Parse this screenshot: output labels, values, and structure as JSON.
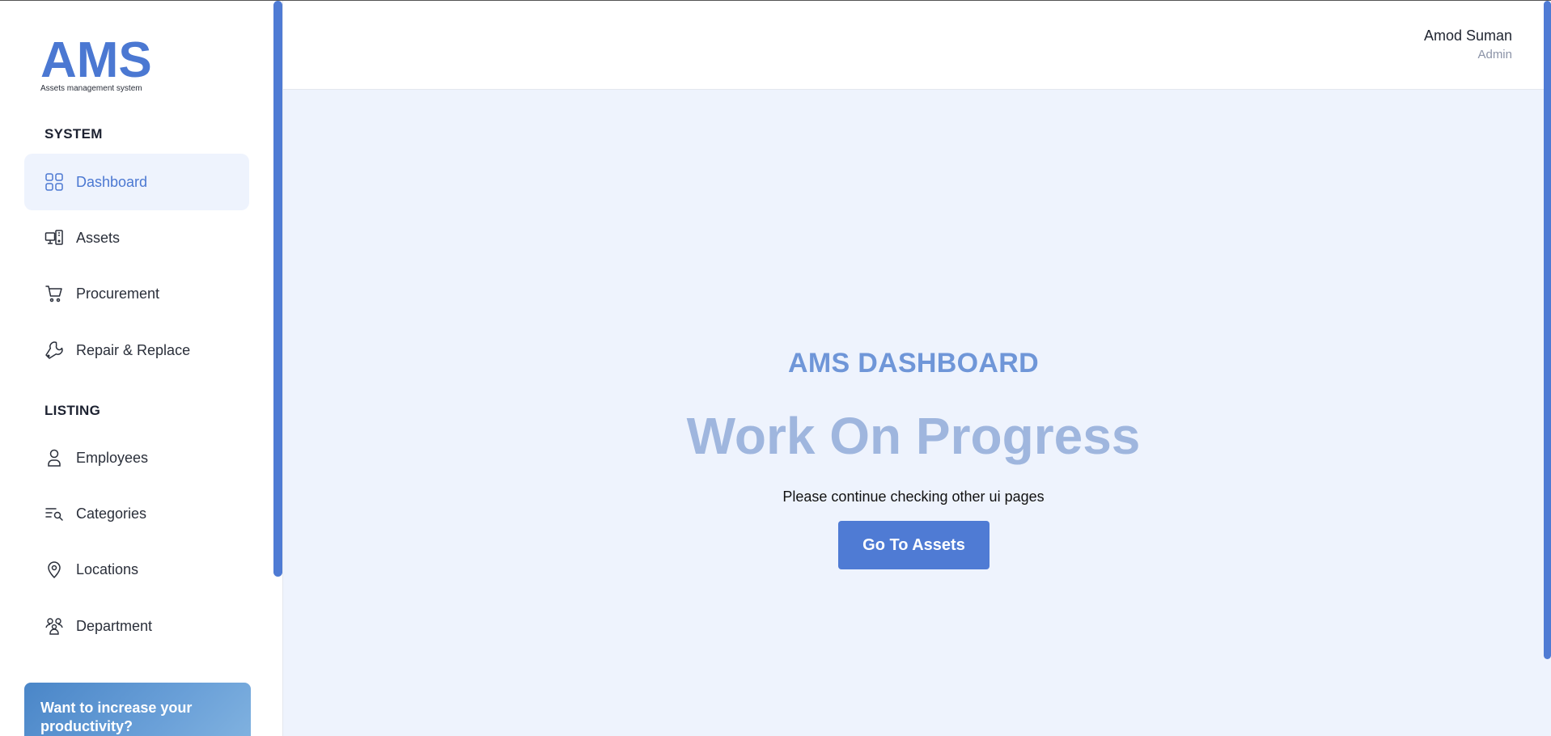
{
  "brand": {
    "logo_text": "AMS",
    "logo_subtitle": "Assets management system"
  },
  "sidebar": {
    "sections": [
      {
        "title": "SYSTEM",
        "items": [
          {
            "label": "Dashboard",
            "icon": "grid-icon",
            "active": true
          },
          {
            "label": "Assets",
            "icon": "devices-icon",
            "active": false
          },
          {
            "label": "Procurement",
            "icon": "cart-icon",
            "active": false
          },
          {
            "label": "Repair & Replace",
            "icon": "wrench-icon",
            "active": false
          }
        ]
      },
      {
        "title": "LISTING",
        "items": [
          {
            "label": "Employees",
            "icon": "user-icon",
            "active": false
          },
          {
            "label": "Categories",
            "icon": "list-search-icon",
            "active": false
          },
          {
            "label": "Locations",
            "icon": "location-pin-icon",
            "active": false
          },
          {
            "label": "Department",
            "icon": "users-group-icon",
            "active": false
          }
        ]
      }
    ],
    "promo": {
      "text": "Want to increase your productivity?"
    }
  },
  "header": {
    "user_name": "Amod Suman",
    "user_role": "Admin"
  },
  "main": {
    "title": "AMS DASHBOARD",
    "headline": "Work On Progress",
    "subtext": "Please continue checking other ui pages",
    "button_label": "Go To Assets"
  },
  "colors": {
    "accent": "#4f7bd4",
    "main_bg": "#eef3fd",
    "headline": "#9fb6de"
  }
}
